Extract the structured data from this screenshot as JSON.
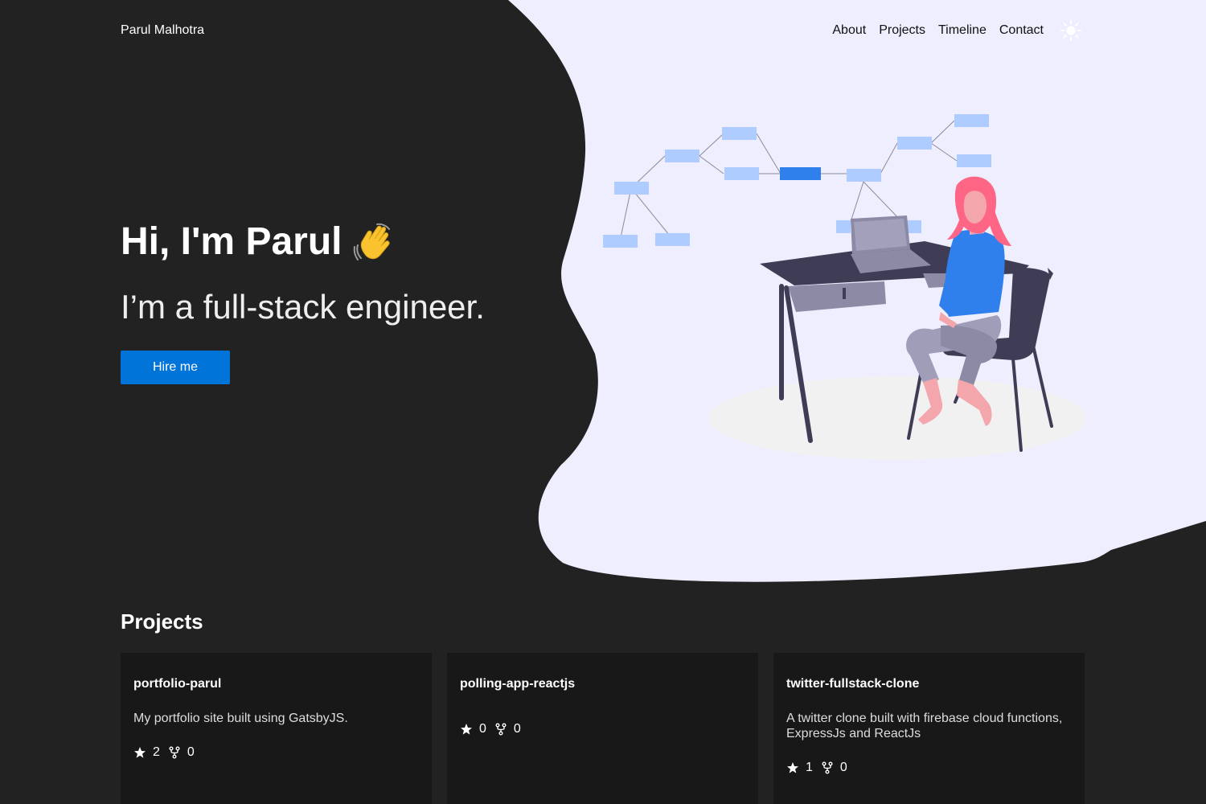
{
  "header": {
    "brand": "Parul Malhotra",
    "nav": [
      {
        "label": "About"
      },
      {
        "label": "Projects"
      },
      {
        "label": "Timeline"
      },
      {
        "label": "Contact"
      }
    ],
    "theme_icon": "sun-icon"
  },
  "hero": {
    "greeting": "Hi, I'm Parul",
    "greeting_icon": "waving-hand-icon",
    "subtitle": "I’m a full-stack engineer.",
    "cta_label": "Hire me",
    "illustration": "person-at-desk-with-laptop-illustration"
  },
  "projects": {
    "title": "Projects",
    "items": [
      {
        "name": "portfolio-parul",
        "description": "My portfolio site built using GatsbyJS.",
        "stars": "2",
        "forks": "0"
      },
      {
        "name": "polling-app-reactjs",
        "description": "",
        "stars": "0",
        "forks": "0"
      },
      {
        "name": "twitter-fullstack-clone",
        "description": "A twitter clone built with firebase cloud functions, ExpressJs and ReactJs",
        "stars": "1",
        "forks": "0"
      }
    ]
  },
  "colors": {
    "background": "#222222",
    "blob": "#eeeeff",
    "accent": "#0074d9",
    "card": "#181818"
  }
}
